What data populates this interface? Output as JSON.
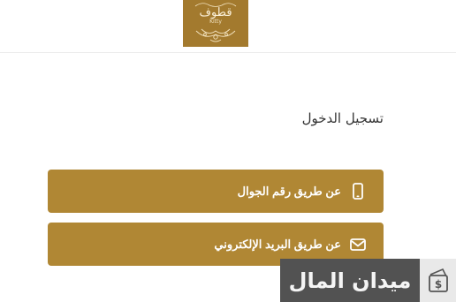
{
  "header": {
    "logo_text": "قطوف",
    "logo_sub": "Kitty"
  },
  "login": {
    "title": "تسجيل الدخول",
    "options": [
      {
        "label": "عن طريق رقم الجوال",
        "icon": "mobile-phone-icon"
      },
      {
        "label": "عن طريق البريد الإلكتروني",
        "icon": "envelope-icon"
      }
    ]
  },
  "watermark": {
    "text": "ميدان المال",
    "icon": "wallet-dollar-icon"
  },
  "colors": {
    "accent": "#b08734",
    "logo_bg": "#a37a2e",
    "watermark_bg": "#525252"
  }
}
